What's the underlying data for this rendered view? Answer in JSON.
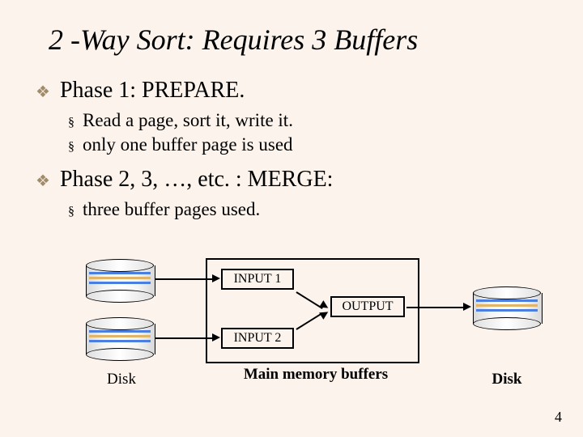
{
  "title": "2 -Way Sort: Requires 3 Buffers",
  "phase1": {
    "heading": "Phase  1:  PREPARE.",
    "items": [
      "Read a page, sort it, write it.",
      "only one buffer page is used"
    ]
  },
  "phase2": {
    "heading": "Phase  2, 3, …, etc. : MERGE:",
    "items": [
      "three buffer pages used."
    ]
  },
  "diagram": {
    "input1": "INPUT 1",
    "input2": "INPUT 2",
    "output": "OUTPUT",
    "disk_left": "Disk",
    "main_label": "Main memory buffers",
    "disk_right": "Disk"
  },
  "page_number": "4"
}
